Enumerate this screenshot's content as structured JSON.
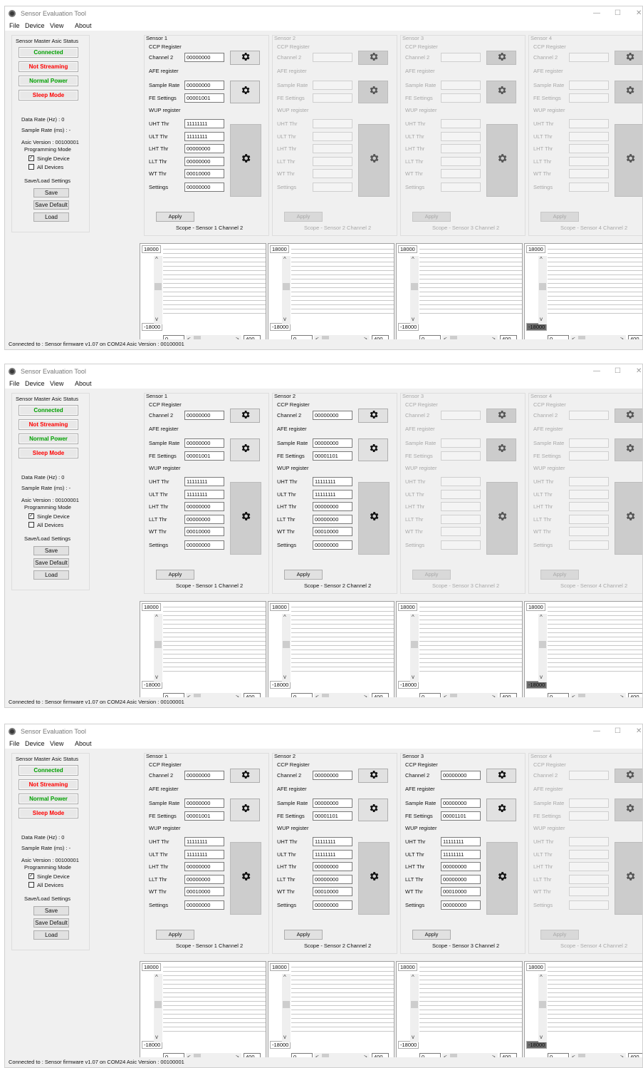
{
  "app": {
    "title": "Sensor Evaluation Tool",
    "menu": [
      "File",
      "Device",
      "View",
      "About"
    ],
    "status_bar": "Connected to : Sensor firmware v1.07 on COM24  Asic Version : 00100001"
  },
  "left_panel": {
    "group_title": "Sensor Master Asic Status",
    "connected": "Connected",
    "streaming": "Not Streaming",
    "power": "Normal Power",
    "sleep": "Sleep Mode",
    "data_rate": "Data Rate (Hz) : 0",
    "sample_rate": "Sample Rate (ms) : -",
    "asic_version": "Asic Version : 00100001",
    "prog_mode_title": "Programming Mode",
    "single_device": "Single Device",
    "all_devices": "All Devices",
    "save_load_title": "Save/Load Settings",
    "save": "Save",
    "save_default": "Save Default",
    "load": "Load"
  },
  "colors": {
    "connected_text": "#00a000",
    "warning_text": "#ff0000",
    "disabled_text": "#a8a8a8"
  },
  "labels": {
    "ccp_register": "CCP Register",
    "channel": "Channel 2",
    "afe_register": "AFE register",
    "sample_rate": "Sample Rate",
    "fe_settings": "FE Settings",
    "wup_register": "WUP register",
    "uht": "UHT Thr",
    "ult": "ULT Thr",
    "lht": "LHT Thr",
    "llt": "LLT Thr",
    "wt": "WT Thr",
    "settings": "Settings",
    "apply": "Apply",
    "gear_icon": "gear-icon"
  },
  "windows": [
    {
      "sensors": [
        {
          "name": "Sensor 1",
          "enabled": true,
          "channel": "00000000",
          "sample_rate": "00000000",
          "fe_settings": "00001001",
          "uht": "11111111",
          "ult": "11111111",
          "lht": "00000000",
          "llt": "00000000",
          "wt": "00010000",
          "settings": "00000000",
          "scope": "Scope - Sensor 1 Channel 2",
          "ymax": "18000",
          "ymin": "-18000",
          "xmin": "0",
          "xmax": "400"
        },
        {
          "name": "Sensor 2",
          "enabled": false,
          "channel": "",
          "sample_rate": "",
          "fe_settings": "",
          "uht": "",
          "ult": "",
          "lht": "",
          "llt": "",
          "wt": "",
          "settings": "",
          "scope": "Scope - Sensor 2 Channel 2",
          "ymax": "18000",
          "ymin": "-18000",
          "xmin": "0",
          "xmax": "400"
        },
        {
          "name": "Sensor 3",
          "enabled": false,
          "channel": "",
          "sample_rate": "",
          "fe_settings": "",
          "uht": "",
          "ult": "",
          "lht": "",
          "llt": "",
          "wt": "",
          "settings": "",
          "scope": "Scope - Sensor 3 Channel 2",
          "ymax": "18000",
          "ymin": "-18000",
          "xmin": "0",
          "xmax": "400"
        },
        {
          "name": "Sensor 4",
          "enabled": false,
          "channel": "",
          "sample_rate": "",
          "fe_settings": "",
          "uht": "",
          "ult": "",
          "lht": "",
          "llt": "",
          "wt": "",
          "settings": "",
          "scope": "Scope - Sensor 4 Channel 2",
          "ymax": "18000",
          "ymin": "-18000",
          "xmin": "0",
          "xmax": "400"
        }
      ]
    },
    {
      "sensors": [
        {
          "name": "Sensor 1",
          "enabled": true,
          "channel": "00000000",
          "sample_rate": "00000000",
          "fe_settings": "00001001",
          "uht": "11111111",
          "ult": "11111111",
          "lht": "00000000",
          "llt": "00000000",
          "wt": "00010000",
          "settings": "00000000",
          "scope": "Scope - Sensor 1 Channel 2",
          "ymax": "18000",
          "ymin": "-18000",
          "xmin": "0",
          "xmax": "400"
        },
        {
          "name": "Sensor 2",
          "enabled": true,
          "channel": "00000000",
          "sample_rate": "00000000",
          "fe_settings": "00001101",
          "uht": "11111111",
          "ult": "11111111",
          "lht": "00000000",
          "llt": "00000000",
          "wt": "00010000",
          "settings": "00000000",
          "scope": "Scope - Sensor 2 Channel 2",
          "ymax": "18000",
          "ymin": "-18000",
          "xmin": "0",
          "xmax": "400"
        },
        {
          "name": "Sensor 3",
          "enabled": false,
          "channel": "",
          "sample_rate": "",
          "fe_settings": "",
          "uht": "",
          "ult": "",
          "lht": "",
          "llt": "",
          "wt": "",
          "settings": "",
          "scope": "Scope - Sensor 3 Channel 2",
          "ymax": "18000",
          "ymin": "-18000",
          "xmin": "0",
          "xmax": "400"
        },
        {
          "name": "Sensor 4",
          "enabled": false,
          "channel": "",
          "sample_rate": "",
          "fe_settings": "",
          "uht": "",
          "ult": "",
          "lht": "",
          "llt": "",
          "wt": "",
          "settings": "",
          "scope": "Scope - Sensor 4 Channel 2",
          "ymax": "18000",
          "ymin": "-18000",
          "xmin": "0",
          "xmax": "400"
        }
      ]
    },
    {
      "sensors": [
        {
          "name": "Sensor 1",
          "enabled": true,
          "channel": "00000000",
          "sample_rate": "00000000",
          "fe_settings": "00001001",
          "uht": "11111111",
          "ult": "11111111",
          "lht": "00000000",
          "llt": "00000000",
          "wt": "00010000",
          "settings": "00000000",
          "scope": "Scope - Sensor 1 Channel 2",
          "ymax": "18000",
          "ymin": "-18000",
          "xmin": "0",
          "xmax": "400"
        },
        {
          "name": "Sensor 2",
          "enabled": true,
          "channel": "00000000",
          "sample_rate": "00000000",
          "fe_settings": "00001101",
          "uht": "11111111",
          "ult": "11111111",
          "lht": "00000000",
          "llt": "00000000",
          "wt": "00010000",
          "settings": "00000000",
          "scope": "Scope - Sensor 2 Channel 2",
          "ymax": "18000",
          "ymin": "-18000",
          "xmin": "0",
          "xmax": "400"
        },
        {
          "name": "Sensor 3",
          "enabled": true,
          "channel": "00000000",
          "sample_rate": "00000000",
          "fe_settings": "00001101",
          "uht": "11111111",
          "ult": "11111111",
          "lht": "00000000",
          "llt": "00000000",
          "wt": "00010000",
          "settings": "00000000",
          "scope": "Scope - Sensor 3 Channel 2",
          "ymax": "18000",
          "ymin": "-18000",
          "xmin": "0",
          "xmax": "400"
        },
        {
          "name": "Sensor 4",
          "enabled": false,
          "channel": "",
          "sample_rate": "",
          "fe_settings": "",
          "uht": "",
          "ult": "",
          "lht": "",
          "llt": "",
          "wt": "",
          "settings": "",
          "scope": "Scope - Sensor 4 Channel 2",
          "ymax": "18000",
          "ymin": "-18000",
          "xmin": "0",
          "xmax": "400"
        }
      ]
    }
  ]
}
